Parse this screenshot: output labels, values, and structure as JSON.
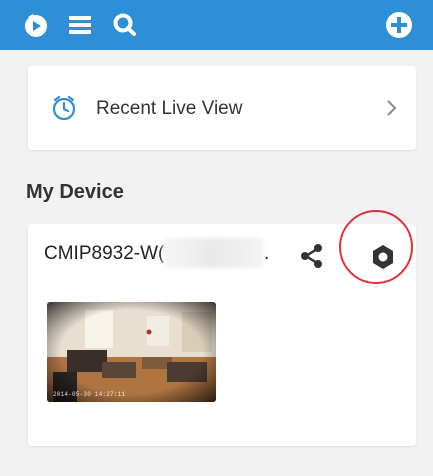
{
  "topbar": {
    "background": "#2d8fd6",
    "left_icons": [
      "play-icon",
      "list-icon",
      "search-icon"
    ],
    "right_icon": "add-icon"
  },
  "recent": {
    "label": "Recent Live View",
    "icon": "clock-icon"
  },
  "section": {
    "title": "My Device"
  },
  "device": {
    "name": "CMIP8932-W(",
    "name_suffix": ".",
    "share_icon": "share-icon",
    "settings_icon": "settings-icon",
    "highlight_color": "#e0323a",
    "thumbnail_timestamp": "2014-05-30 14:27:11"
  }
}
